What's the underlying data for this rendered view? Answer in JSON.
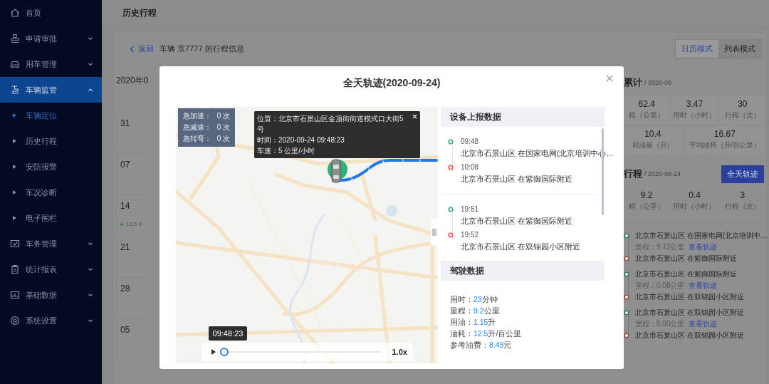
{
  "sidebar": {
    "items": [
      {
        "kind": "link",
        "label": "首页",
        "selected": false
      },
      {
        "kind": "group",
        "label": "申请审批",
        "expanded": false,
        "selected": false
      },
      {
        "kind": "group",
        "label": "用车管理",
        "expanded": false,
        "selected": false
      },
      {
        "kind": "group",
        "label": "车辆监管",
        "expanded": true,
        "selected": true,
        "children": [
          {
            "label": "车辆定位",
            "selected": true
          },
          {
            "label": "历史行程",
            "selected": false
          },
          {
            "label": "安防报警",
            "selected": false
          },
          {
            "label": "车况诊断",
            "selected": false
          },
          {
            "label": "电子围栏",
            "selected": false
          }
        ]
      },
      {
        "kind": "group",
        "label": "车务管理",
        "expanded": false,
        "selected": false
      },
      {
        "kind": "group",
        "label": "统计报表",
        "expanded": false,
        "selected": false
      },
      {
        "kind": "group",
        "label": "基础数据",
        "expanded": false,
        "selected": false
      },
      {
        "kind": "group",
        "label": "系统设置",
        "expanded": false,
        "selected": false
      }
    ]
  },
  "header": {
    "title": "历史行程"
  },
  "toolbar": {
    "back": "返回",
    "caption": "车辆 京7777 的行程信息",
    "modes": [
      {
        "label": "日历模式",
        "selected": true
      },
      {
        "label": "列表模式",
        "selected": false
      }
    ]
  },
  "calendar": {
    "heading": "2020年0",
    "days": [
      {
        "date": "31"
      },
      {
        "date": "07"
      },
      {
        "date": "14",
        "trip": "13.5 K"
      },
      {
        "date": "21"
      },
      {
        "date": "28"
      },
      {
        "date": "05"
      }
    ]
  },
  "month_summary": {
    "title": "累计",
    "date": "/ 2020-09",
    "stats": [
      {
        "value": "62.4",
        "label": "程（公里）"
      },
      {
        "value": "3.47",
        "label": "用时（小时）"
      },
      {
        "value": "30",
        "label": "行程（次）"
      }
    ],
    "stats_2": [
      {
        "value": "10.4",
        "label": "耗油量（升）"
      },
      {
        "value": "16.67",
        "label": "平均油耗（升/百公里）"
      }
    ]
  },
  "day_summary": {
    "title": "行程",
    "date": "/ 2020-09-24",
    "button": "全天轨迹",
    "stats": [
      {
        "value": "9.2",
        "label": "程（公里）"
      },
      {
        "value": "0.4",
        "label": "用时（小时）"
      },
      {
        "value": "3",
        "label": "行程（次）"
      }
    ],
    "trips": [
      {
        "start": "北京市石景山区 在国家电网(北京培训中…",
        "mileage": "里程：9.12公里",
        "link": "查看轨迹",
        "end": "北京市石景山区 在紫御国际附近"
      },
      {
        "start": "北京市石景山区 在紫御国际附近",
        "mileage": "里程：0.08公里",
        "link": "查看轨迹",
        "end": "北京市石景山区 在双锦园小区附近"
      },
      {
        "start": "北京市石景山区 在双锦园小区附近",
        "mileage": "里程：0.00公里",
        "link": "查看轨迹",
        "end": "北京市石景山区 在双锦园小区附近"
      }
    ]
  },
  "modal": {
    "title": "全天轨迹(2020-09-24)",
    "events": [
      {
        "label": "急加速：",
        "count": "0 次"
      },
      {
        "label": "急减速：",
        "count": "0 次"
      },
      {
        "label": "急转弯：",
        "count": "0 次"
      }
    ],
    "info": [
      "位置：北京市石景山区金顶街街道模式口大街5号",
      "时间：2020-09-24 09:48:23",
      "车速：5 公里/小时"
    ],
    "player": {
      "time": "09:48:23",
      "level": 0,
      "speed": "1.0x"
    },
    "report": {
      "title": "设备上报数据",
      "trips": [
        [
          {
            "kind": "start",
            "time": "09:48",
            "place": "北京市石景山区 在国家电网(北京培训中心…"
          },
          {
            "kind": "end",
            "time": "10:08",
            "place": "北京市石景山区 在紫御国际附近"
          }
        ],
        [
          {
            "kind": "start",
            "time": "19:51",
            "place": "北京市石景山区 在紫御国际附近"
          },
          {
            "kind": "end",
            "time": "19:52",
            "place": "北京市石景山区 在双锦园小区附近"
          }
        ]
      ]
    },
    "driving": {
      "title": "驾驶数据",
      "rows": [
        {
          "label": "用时：",
          "value": "23",
          "unit": "分钟"
        },
        {
          "label": "里程：",
          "value": "9.2",
          "unit": "公里"
        },
        {
          "label": "用油：",
          "value": "1.15",
          "unit": "升"
        },
        {
          "label": "油耗：",
          "value": "12.5",
          "unit": "升/百公里"
        },
        {
          "label": "参考油费：",
          "value": "8.43",
          "unit": "元"
        }
      ]
    }
  }
}
